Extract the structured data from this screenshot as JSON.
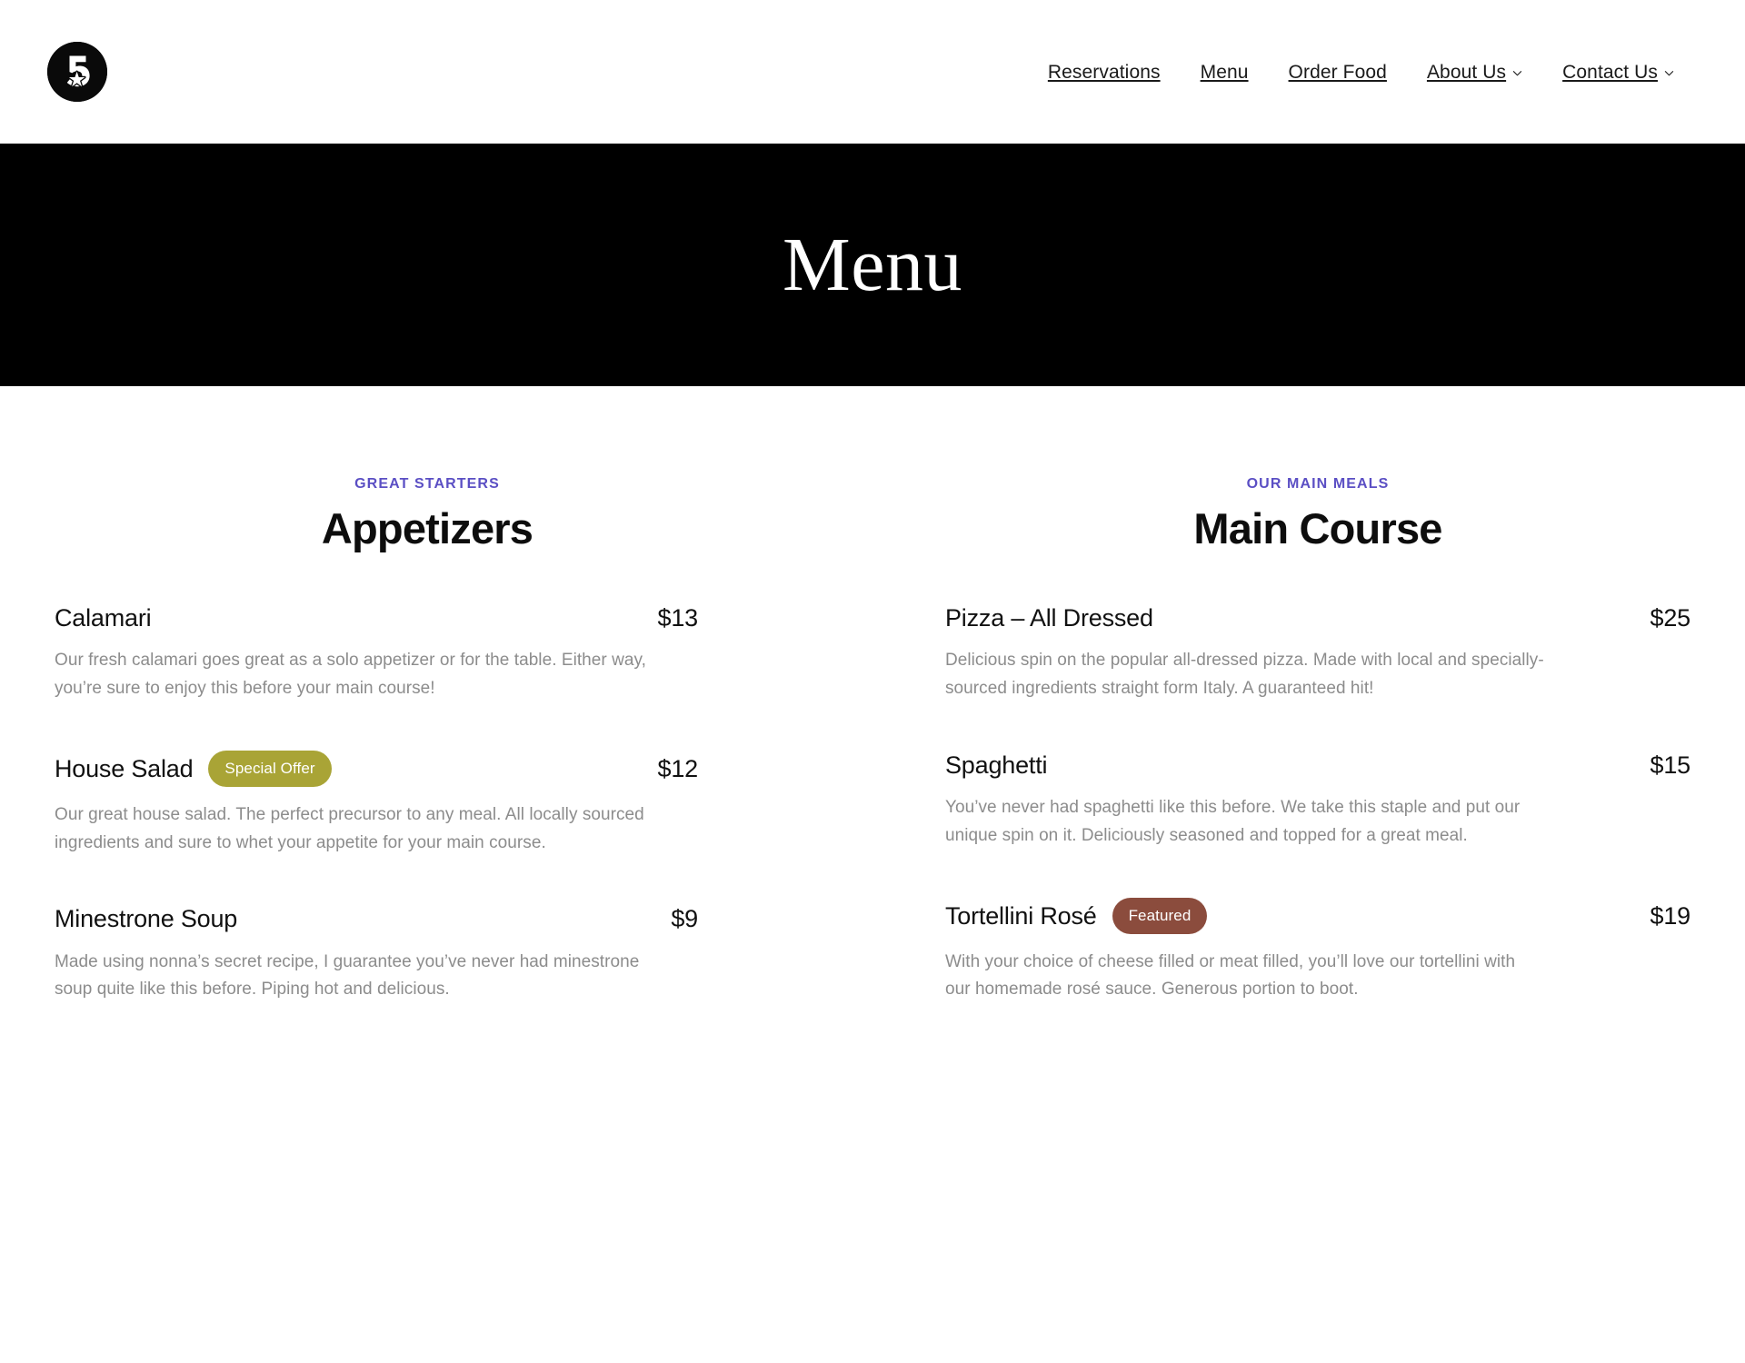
{
  "site": {
    "logo_label": "5-star-logo",
    "logo_digit": "5"
  },
  "nav": {
    "items": [
      {
        "label": "Reservations",
        "has_dropdown": false
      },
      {
        "label": "Menu",
        "has_dropdown": false
      },
      {
        "label": "Order Food",
        "has_dropdown": false
      },
      {
        "label": "About Us",
        "has_dropdown": true
      },
      {
        "label": "Contact Us",
        "has_dropdown": true
      }
    ]
  },
  "hero": {
    "title": "Menu",
    "background_color": "#000000",
    "text_color": "#ffffff"
  },
  "colors": {
    "eyebrow": "#5b4fc4",
    "badge_special_offer": "#a9a436",
    "badge_featured": "#8b4c3d",
    "description_text": "#8c8c8c",
    "heading_text": "#0d0d0d"
  },
  "sections": [
    {
      "eyebrow": "GREAT STARTERS",
      "title": "Appetizers",
      "items": [
        {
          "name": "Calamari",
          "price": "$13",
          "badge": null,
          "description": "Our fresh calamari goes great as a solo appetizer or for the table. Either way, you’re sure to enjoy this before your main course!"
        },
        {
          "name": "House Salad",
          "price": "$12",
          "badge": "Special Offer",
          "description": "Our great house salad. The perfect precursor to any meal. All locally sourced ingredients and sure to whet your appetite for your main course."
        },
        {
          "name": "Minestrone Soup",
          "price": "$9",
          "badge": null,
          "description": "Made using nonna’s secret recipe, I guarantee you’ve never had minestrone soup quite like this before. Piping hot and delicious."
        }
      ]
    },
    {
      "eyebrow": "OUR MAIN MEALS",
      "title": "Main Course",
      "items": [
        {
          "name": "Pizza – All Dressed",
          "price": "$25",
          "badge": null,
          "description": "Delicious spin on the popular all-dressed pizza. Made with local and specially-sourced ingredients straight form Italy. A guaranteed hit!"
        },
        {
          "name": "Spaghetti",
          "price": "$15",
          "badge": null,
          "description": "You’ve never had spaghetti like this before. We take this staple and put our unique spin on it. Deliciously seasoned and topped for a great meal."
        },
        {
          "name": "Tortellini Rosé",
          "price": "$19",
          "badge": "Featured",
          "description": "With your choice of cheese filled or meat filled, you’ll love our tortellini with our homemade rosé sauce. Generous portion to boot."
        }
      ]
    }
  ]
}
